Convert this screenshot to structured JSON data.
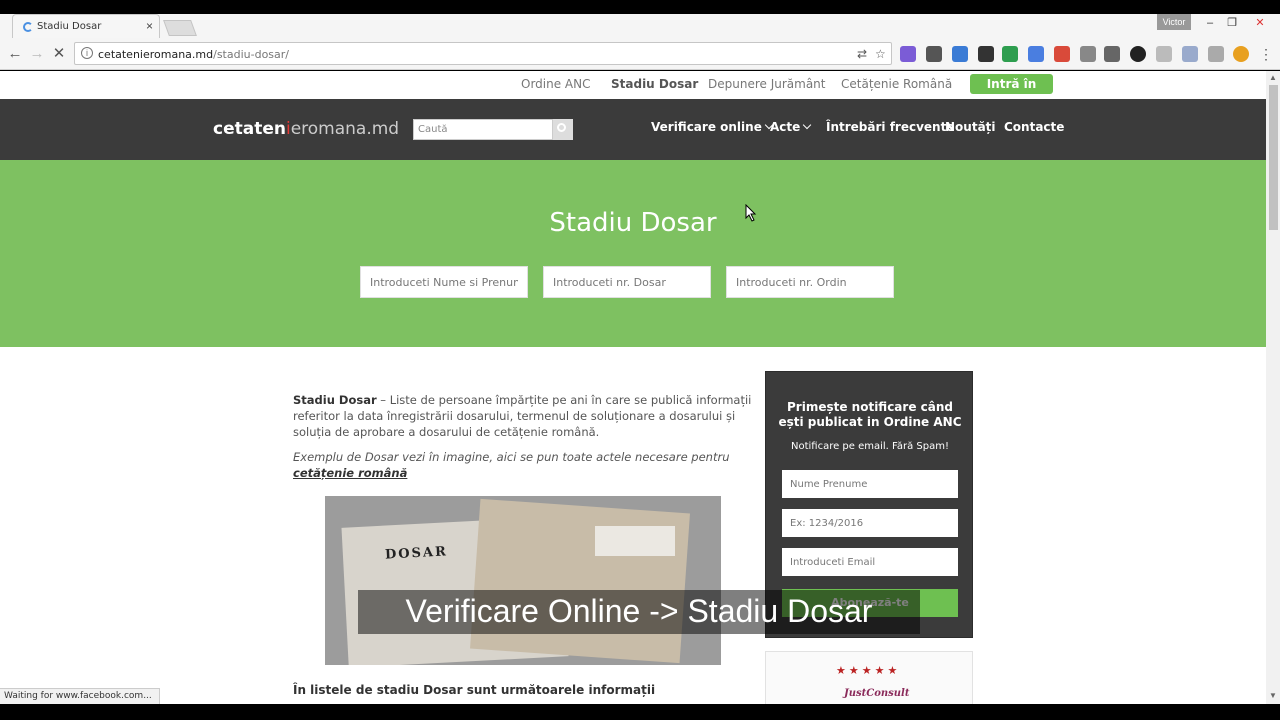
{
  "browser": {
    "tab_title": "Stadiu Dosar",
    "tab_close": "×",
    "user": "Victor",
    "url_host": "cetatenieromana.md",
    "url_path": "/stadiu-dosar/",
    "status_text": "Waiting for www.facebook.com..."
  },
  "topnav": {
    "items": [
      "Ordine ANC",
      "Stadiu Dosar",
      "Depunere Jurământ",
      "Cetățenie Română"
    ],
    "login": "Intră în cont"
  },
  "header": {
    "logo_bold": "cetaten",
    "logo_mark": "i",
    "logo_light": "eromana.md",
    "search_placeholder": "Caută",
    "nav": [
      "Verificare online",
      "Acte",
      "Întrebări frecvente",
      "Noutăți",
      "Contacte"
    ]
  },
  "hero": {
    "title": "Stadiu Dosar",
    "inputs": [
      "Introduceti Nume si Prenume",
      "Introduceti nr. Dosar",
      "Introduceti nr. Ordin"
    ]
  },
  "content": {
    "intro_strong": "Stadiu Dosar",
    "intro_text": " – Liste de persoane împărțite pe ani în care se publică informații referitor la data înregistrării dosarului, termenul de soluționare a dosarului și soluția de aprobare a dosarului de cetățenie română.",
    "example_text": "Exemplu de Dosar vezi în imagine, aici se pun toate actele necesare pentru ",
    "example_link": "cetățenie română",
    "photo_label": "DOSAR",
    "subhead": "În listele de stadiu Dosar sunt următoarele informații"
  },
  "sidebar": {
    "title": "Primește notificare când ești publicat in Ordine ANC",
    "subtitle": "Notificare pe email. Fără Spam!",
    "inputs": [
      "Nume Prenume",
      "Ex: 1234/2016",
      "Introduceti Email"
    ],
    "button": "Abonează-te",
    "badge_stars": "★★★★★",
    "badge_brand": "JustConsult"
  },
  "overlay_caption": "Verificare Online -> Stadiu Dosar"
}
